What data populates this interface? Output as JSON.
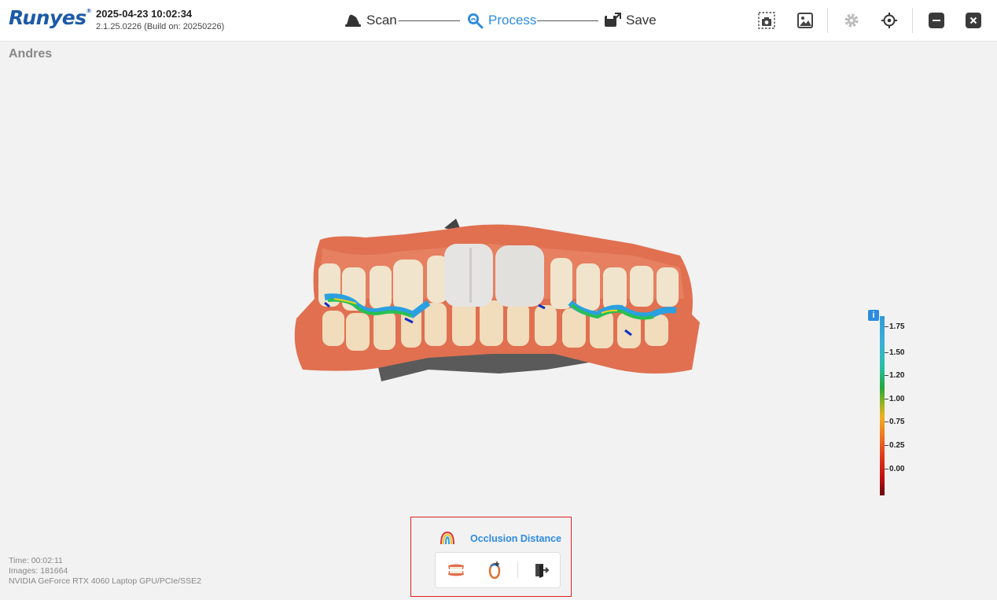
{
  "app": {
    "logo_text": "Runyes",
    "logo_mark": "®",
    "datetime": "2025-04-23 10:02:34",
    "version": "2.1.25.0226 (Build on: 20250226)"
  },
  "steps": [
    {
      "label": "Scan",
      "icon": "scanner-icon",
      "active": false
    },
    {
      "label": "Process",
      "icon": "process-search-icon",
      "active": true
    },
    {
      "label": "Save",
      "icon": "save-export-icon",
      "active": false
    }
  ],
  "toolbar_icons": [
    "screenshot-icon",
    "gallery-icon",
    "settings-icon",
    "target-icon",
    "minimize-icon",
    "close-icon"
  ],
  "patient_name": "Andres",
  "color_scale": {
    "labels": [
      "1.75",
      "1.50",
      "1.20",
      "1.00",
      "0.75",
      "0.25",
      "0.00"
    ],
    "info_glyph": "i"
  },
  "occlusion_panel": {
    "title": "Occlusion Distance",
    "tools": [
      "occlusion-view-icon",
      "bite-rotate-icon",
      "exit-icon"
    ]
  },
  "status": {
    "time": "Time: 00:02:11",
    "images": "Images: 181664",
    "gpu": "NVIDIA GeForce RTX 4060 Laptop GPU/PCIe/SSE2"
  },
  "colors": {
    "brand": "#1c5aa8",
    "accent": "#2d8be0",
    "highlight_border": "#e02020",
    "background": "#f2f2f2"
  }
}
